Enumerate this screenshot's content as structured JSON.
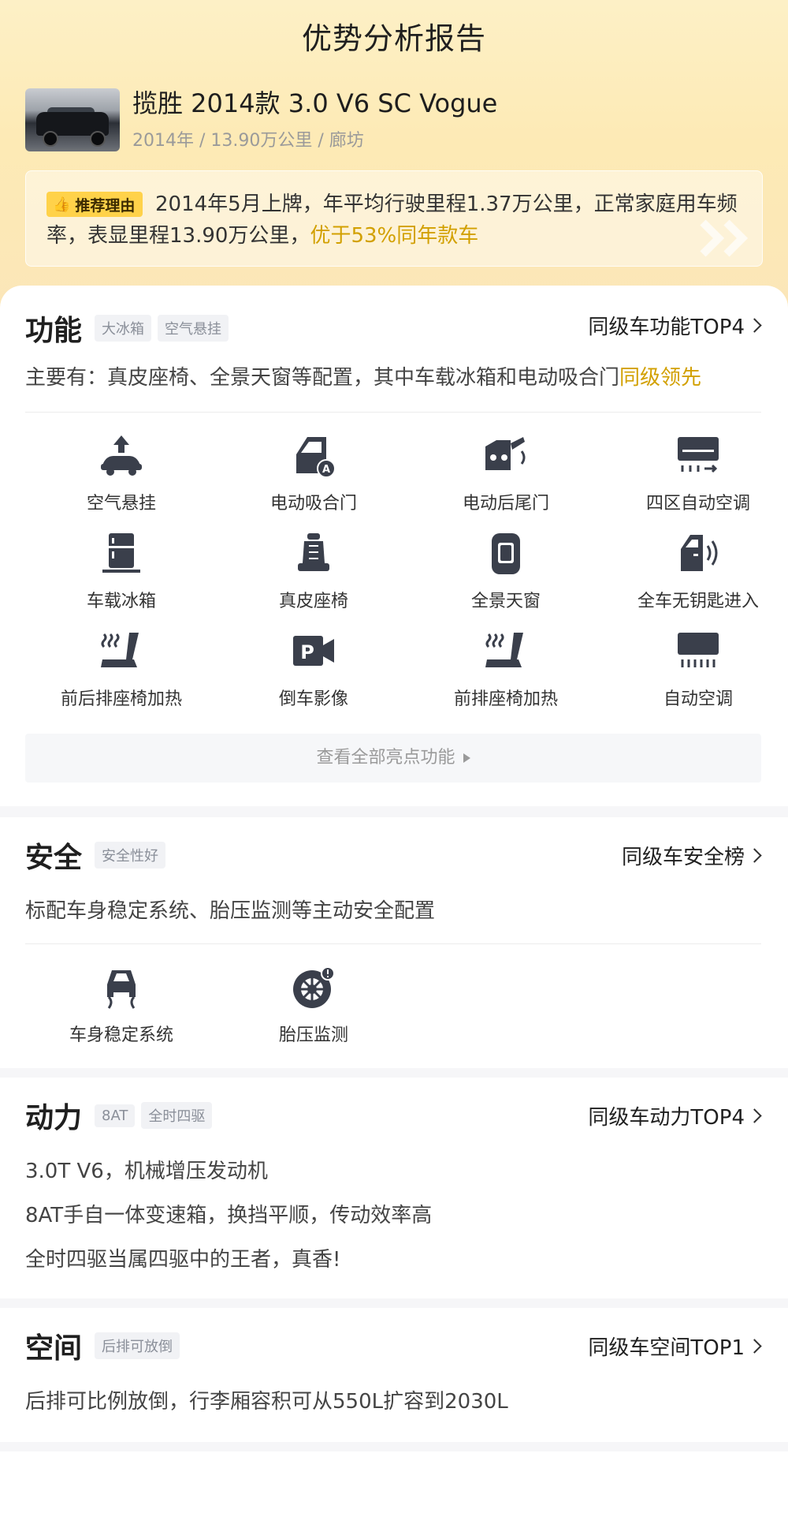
{
  "header": {
    "title": "优势分析报告"
  },
  "car": {
    "name": "揽胜 2014款 3.0 V6 SC Vogue",
    "meta": "2014年 / 13.90万公里 / 廊坊"
  },
  "recommend": {
    "badge": "推荐理由",
    "text": "2014年5月上牌，年平均行驶里程1.37万公里，正常家庭用车频率，表显里程13.90万公里，",
    "highlight": "优于53%同年款车"
  },
  "features": {
    "title": "功能",
    "tags": [
      "大冰箱",
      "空气悬挂"
    ],
    "link": "同级车功能TOP4",
    "desc": "主要有：真皮座椅、全景天窗等配置，其中车载冰箱和电动吸合门",
    "desc_highlight": "同级领先",
    "items": [
      {
        "label": "空气悬挂",
        "icon": "air-suspension-icon"
      },
      {
        "label": "电动吸合门",
        "icon": "soft-close-door-icon"
      },
      {
        "label": "电动后尾门",
        "icon": "power-tailgate-icon"
      },
      {
        "label": "四区自动空调",
        "icon": "four-zone-ac-icon"
      },
      {
        "label": "车载冰箱",
        "icon": "fridge-icon"
      },
      {
        "label": "真皮座椅",
        "icon": "leather-seat-icon"
      },
      {
        "label": "全景天窗",
        "icon": "panoramic-sunroof-icon"
      },
      {
        "label": "全车无钥匙进入",
        "icon": "keyless-entry-icon"
      },
      {
        "label": "前后排座椅加热",
        "icon": "seat-heating-icon"
      },
      {
        "label": "倒车影像",
        "icon": "reverse-camera-icon"
      },
      {
        "label": "前排座椅加热",
        "icon": "front-seat-heating-icon"
      },
      {
        "label": "自动空调",
        "icon": "auto-ac-icon"
      }
    ],
    "view_all": "查看全部亮点功能"
  },
  "safety": {
    "title": "安全",
    "tags": [
      "安全性好"
    ],
    "link": "同级车安全榜",
    "desc": "标配车身稳定系统、胎压监测等主动安全配置",
    "items": [
      {
        "label": "车身稳定系统",
        "icon": "stability-control-icon"
      },
      {
        "label": "胎压监测",
        "icon": "tire-pressure-icon"
      }
    ]
  },
  "power": {
    "title": "动力",
    "tags": [
      "8AT",
      "全时四驱"
    ],
    "link": "同级车动力TOP4",
    "lines": [
      "3.0T V6，机械增压发动机",
      "8AT手自一体变速箱，换挡平顺，传动效率高",
      "全时四驱当属四驱中的王者，真香!"
    ]
  },
  "space": {
    "title": "空间",
    "tags": [
      "后排可放倒"
    ],
    "link": "同级车空间TOP1",
    "desc": "后排可比例放倒，行李厢容积可从550L扩容到2030L"
  },
  "colors": {
    "accent": "#d2a000",
    "badge": "#ffd24a",
    "icon": "#3a3f4b"
  }
}
